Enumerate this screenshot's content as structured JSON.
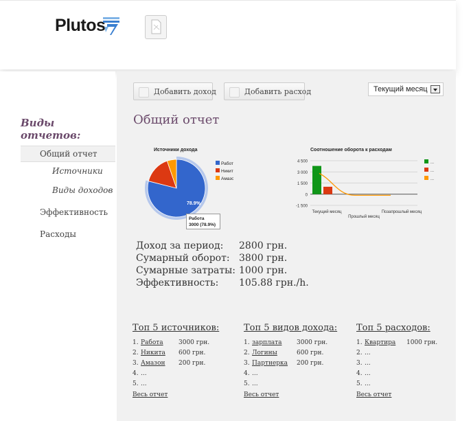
{
  "header": {
    "logo_text": "Plutos",
    "logo_colors": {
      "stripe": "#3a7fd0",
      "stripe_light": "#7fb3e6"
    }
  },
  "sidebar": {
    "title": "Виды отчетов:",
    "items": [
      {
        "label": "Общий отчет",
        "active": true
      },
      {
        "label": "Источники",
        "sub": true
      },
      {
        "label": "Виды доходов",
        "sub": true
      },
      {
        "label": "Эффективность"
      },
      {
        "label": "Расходы"
      }
    ]
  },
  "toolbar": {
    "add_income_label": "Добавить доход",
    "add_expense_label": "Добавить расход",
    "period_value": "Текущий месяц"
  },
  "page_title": "Общий отчет",
  "charts": {
    "pie": {
      "title": "Источники дохода",
      "slice_label": "78.9%",
      "tooltip_line1": "Работа",
      "tooltip_line2": "3000 (78.9%)"
    },
    "bar": {
      "title": "Соотношение оборота к расходам",
      "x_cat1": "Текущий месяц",
      "x_cat2": "Позапрошлый месяц",
      "x_cat_mid": "Прошлый месяц",
      "legend_dots": [
        "...",
        "...",
        "..."
      ]
    }
  },
  "chart_data": [
    {
      "type": "pie",
      "title": "Источники дохода",
      "labels": [
        "Работа",
        "Никита",
        "Амазон"
      ],
      "values": [
        3000,
        600,
        200
      ],
      "colors": [
        "#3366cc",
        "#dc3912",
        "#ff9900"
      ],
      "legend": "right"
    },
    {
      "type": "bar",
      "title": "Соотношение оборота к расходам",
      "categories": [
        "Текущий месяц",
        "Прошлый месяц",
        "Позапрошлый месяц"
      ],
      "series": [
        {
          "values": [
            3800,
            0,
            0
          ],
          "color": "#109618"
        },
        {
          "values": [
            1000,
            0,
            0
          ],
          "color": "#dc3912"
        },
        {
          "values": [
            2800,
            -150,
            -150
          ],
          "color": "#ff9900"
        }
      ],
      "yticks": [
        "4 500",
        "3 000",
        "1 500",
        "0",
        "-1 500"
      ],
      "ylim": [
        -1500,
        4500
      ],
      "legend": "right"
    }
  ],
  "stats": [
    {
      "label": "Доход за период:",
      "value": "2800 грн."
    },
    {
      "label": "Сумарный оборот:",
      "value": "3800 грн."
    },
    {
      "label": "Сумарные затраты:",
      "value": "1000 грн."
    },
    {
      "label": "Эффективность:",
      "value": "105.88 грн./h."
    }
  ],
  "top5": [
    {
      "title": "Топ 5 источников:",
      "items": [
        {
          "n": "1.",
          "name": "Работа",
          "amount": "3000 грн."
        },
        {
          "n": "2.",
          "name": "Никита",
          "amount": "600 грн."
        },
        {
          "n": "3.",
          "name": "Амазон",
          "amount": "200 грн."
        },
        {
          "n": "4.",
          "name": "..."
        },
        {
          "n": "5.",
          "name": "..."
        }
      ],
      "all_label": "Весь отчет"
    },
    {
      "title": "Топ 5 видов дохода:",
      "items": [
        {
          "n": "1.",
          "name": "зарплата",
          "amount": "3000 грн."
        },
        {
          "n": "2.",
          "name": "Логины",
          "amount": "600 грн."
        },
        {
          "n": "3.",
          "name": "Партнерка",
          "amount": "200 грн."
        },
        {
          "n": "4.",
          "name": "..."
        },
        {
          "n": "5.",
          "name": "..."
        }
      ],
      "all_label": "Весь отчет"
    },
    {
      "title": "Топ 5 расходов:",
      "items": [
        {
          "n": "1.",
          "name": "Квартира",
          "amount": "1000 грн."
        },
        {
          "n": "2.",
          "name": "..."
        },
        {
          "n": "3.",
          "name": "..."
        },
        {
          "n": "4.",
          "name": "..."
        },
        {
          "n": "5.",
          "name": "..."
        }
      ],
      "all_label": "Весь отчет"
    }
  ]
}
